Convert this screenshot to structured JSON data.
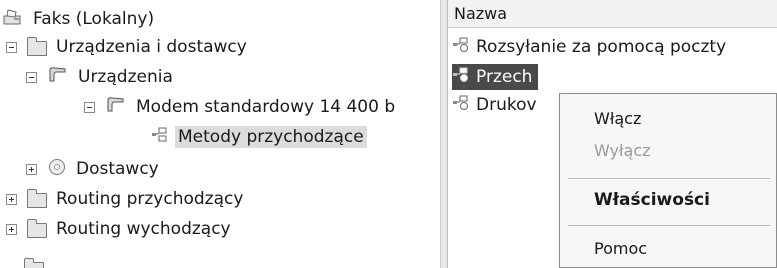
{
  "tree": {
    "root": {
      "label": "Faks (Lokalny)",
      "icon": "fax-icon"
    },
    "devices_providers": {
      "label": "Urządzenia i dostawcy",
      "icon": "folder-icon"
    },
    "devices": {
      "label": "Urządzenia",
      "icon": "devices-icon"
    },
    "modem": {
      "label": "Modem standardowy 14 400 b",
      "icon": "modem-icon"
    },
    "incoming_methods": {
      "label": "Metody przychodzące",
      "icon": "method-icon"
    },
    "providers": {
      "label": "Dostawcy",
      "icon": "provider-icon"
    },
    "routing_in": {
      "label": "Routing przychodzący",
      "icon": "folder-icon"
    },
    "routing_out": {
      "label": "Routing wychodzący",
      "icon": "folder-icon"
    }
  },
  "list": {
    "column_header": "Nazwa",
    "items": [
      {
        "label": "Rozsyłanie za pomocą poczty",
        "icon": "method-icon"
      },
      {
        "label": "Przech",
        "icon": "method-icon",
        "selected": true
      },
      {
        "label": "Drukov",
        "icon": "method-icon"
      }
    ]
  },
  "context_menu": {
    "items": [
      {
        "label": "Włącz",
        "enabled": true
      },
      {
        "label": "Wyłącz",
        "enabled": false
      },
      {
        "label": "Właściwości",
        "enabled": true,
        "default": true
      },
      {
        "label": "Pomoc",
        "enabled": true
      }
    ]
  },
  "colors": {
    "selection_light": "#dcdcdc",
    "selection_dark": "#4a4a4a",
    "disabled_text": "#9a9a9a"
  }
}
